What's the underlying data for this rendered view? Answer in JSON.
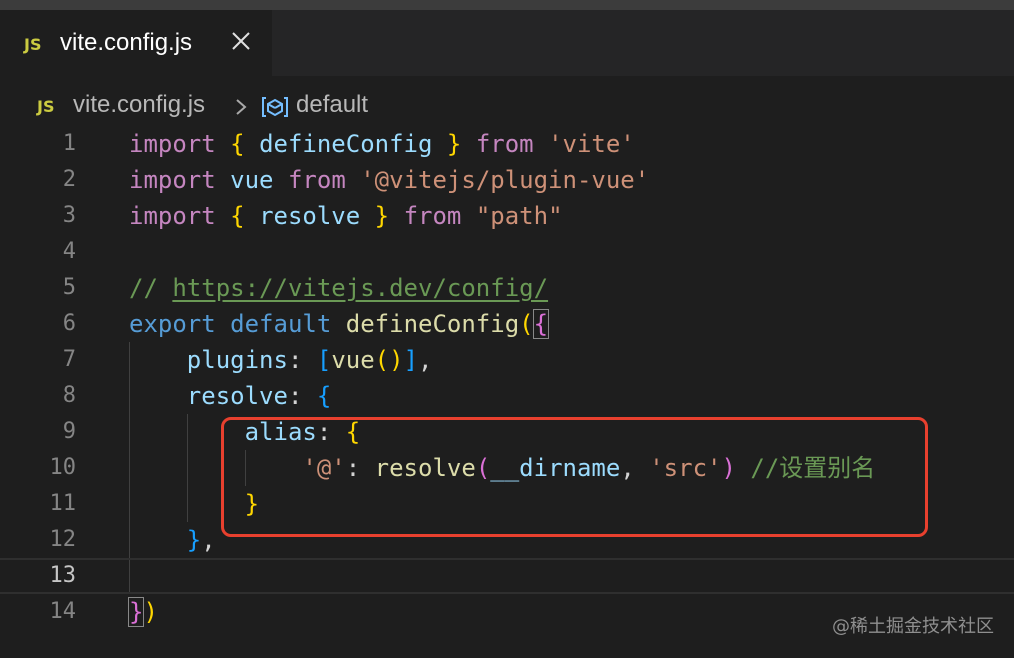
{
  "tab": {
    "icon": "JS",
    "title": "vite.config.js"
  },
  "breadcrumb": {
    "icon": "JS",
    "file": "vite.config.js",
    "symbol": "default"
  },
  "editor": {
    "line_numbers": [
      "1",
      "2",
      "3",
      "4",
      "5",
      "6",
      "7",
      "8",
      "9",
      "10",
      "11",
      "12",
      "13",
      "14"
    ],
    "current_line": "13",
    "lines": {
      "l1": {
        "t1": "import",
        "t2": "{",
        "t3": "defineConfig",
        "t4": "}",
        "t5": "from",
        "t6": "'vite'"
      },
      "l2": {
        "t1": "import",
        "t2": "vue",
        "t3": "from",
        "t4": "'@vitejs/plugin-vue'"
      },
      "l3": {
        "t1": "import",
        "t2": "{",
        "t3": "resolve",
        "t4": "}",
        "t5": "from",
        "t6": "\"path\""
      },
      "l5": {
        "t1": "//",
        "t2": "https://vitejs.dev/config/"
      },
      "l6": {
        "t1": "export",
        "t2": "default",
        "t3": "defineConfig",
        "t4": "(",
        "t5": "{"
      },
      "l7": {
        "t1": "plugins",
        "t2": ":",
        "t3": "[",
        "t4": "vue",
        "t5": "()",
        "t6": "]",
        "t7": ","
      },
      "l8": {
        "t1": "resolve",
        "t2": ":",
        "t3": "{"
      },
      "l9": {
        "t1": "alias",
        "t2": ":",
        "t3": "{"
      },
      "l10": {
        "t1": "'@'",
        "t2": ":",
        "t3": "resolve",
        "t4": "(",
        "t5": "__dirname",
        "t6": ",",
        "t7": "'src'",
        "t8": ")",
        "t9": "//设置别名"
      },
      "l11": {
        "t1": "}"
      },
      "l12": {
        "t1": "}",
        "t2": ","
      },
      "l14": {
        "t1": "}",
        "t2": ")"
      }
    }
  },
  "watermark": "@稀土掘金技术社区",
  "colors": {
    "background": "#1e1e1e",
    "keyword": "#c586c0",
    "string": "#ce9178",
    "function": "#dcdcaa",
    "variable": "#9cdcfe",
    "comment": "#6a9955",
    "highlight_box": "#e8402e"
  },
  "icons": {
    "tab_close": "close-icon",
    "breadcrumb_separator": "chevron-right-icon",
    "breadcrumb_symbol": "symbol-variable-icon"
  }
}
